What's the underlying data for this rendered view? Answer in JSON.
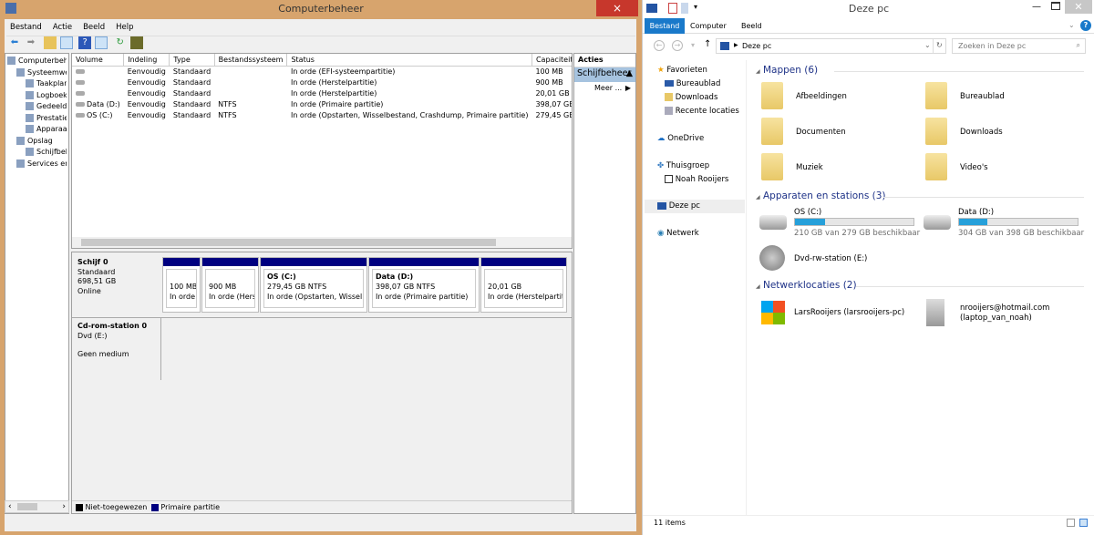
{
  "computer_management": {
    "title": "Computerbeheer",
    "close_icon": "×",
    "menu": [
      "Bestand",
      "Actie",
      "Beeld",
      "Help"
    ],
    "tree": [
      {
        "label": "Computerbeheer",
        "level": 0
      },
      {
        "label": "Systeemwerkset",
        "level": 1
      },
      {
        "label": "Taakplanner",
        "level": 2
      },
      {
        "label": "Logboeken",
        "level": 2
      },
      {
        "label": "Gedeelde mappen",
        "level": 2
      },
      {
        "label": "Prestaties",
        "level": 2
      },
      {
        "label": "Apparaatbeheer",
        "level": 2
      },
      {
        "label": "Opslag",
        "level": 1
      },
      {
        "label": "Schijfbeheer",
        "level": 2
      },
      {
        "label": "Services en toepassingen",
        "level": 1
      }
    ],
    "columns": [
      "Volume",
      "Indeling",
      "Type",
      "Bestandssysteem",
      "Status",
      "Capaciteit"
    ],
    "rows": [
      [
        "",
        "Eenvoudig",
        "Standaard",
        "",
        "In orde (EFI-systeempartitie)",
        "100 MB"
      ],
      [
        "",
        "Eenvoudig",
        "Standaard",
        "",
        "In orde (Herstelpartitie)",
        "900 MB"
      ],
      [
        "",
        "Eenvoudig",
        "Standaard",
        "",
        "In orde (Herstelpartitie)",
        "20,01 GB"
      ],
      [
        "Data (D:)",
        "Eenvoudig",
        "Standaard",
        "NTFS",
        "In orde (Primaire partitie)",
        "398,07 GB"
      ],
      [
        "OS (C:)",
        "Eenvoudig",
        "Standaard",
        "NTFS",
        "In orde (Opstarten, Wisselbestand, Crashdump, Primaire partitie)",
        "279,45 GB"
      ]
    ],
    "disk0": {
      "name": "Schijf 0",
      "type": "Standaard",
      "size": "698,51 GB",
      "state": "Online",
      "partitions": [
        {
          "title": "",
          "size": "100 MB",
          "status": "In orde (EFI-systeempartitie)"
        },
        {
          "title": "",
          "size": "900 MB",
          "status": "In orde (Herstelpartitie)"
        },
        {
          "title": "OS  (C:)",
          "size": "279,45 GB NTFS",
          "status": "In orde (Opstarten, Wisselbestand, Crashdump, Primaire partitie)"
        },
        {
          "title": "Data  (D:)",
          "size": "398,07 GB NTFS",
          "status": "In orde (Primaire partitie)"
        },
        {
          "title": "",
          "size": "20,01 GB",
          "status": "In orde (Herstelpartitie)"
        }
      ]
    },
    "cdrom": {
      "name": "Cd-rom-station 0",
      "type": "Dvd (E:)",
      "state": "Geen medium"
    },
    "legend": [
      {
        "label": "Niet-toegewezen",
        "color": "#000000"
      },
      {
        "label": "Primaire partitie",
        "color": "#000080"
      }
    ],
    "actions": {
      "header": "Acties",
      "section": "Schijfbeheer",
      "more": "Meer ..."
    }
  },
  "explorer": {
    "title": "Deze pc",
    "tabs": [
      "Bestand",
      "Computer",
      "Beeld"
    ],
    "address": "Deze pc",
    "search_placeholder": "Zoeken in Deze pc",
    "nav": {
      "favorites": "Favorieten",
      "fav_items": [
        "Bureaublad",
        "Downloads",
        "Recente locaties"
      ],
      "onedrive": "OneDrive",
      "homegroup": "Thuisgroep",
      "homegroup_user": "Noah Rooijers",
      "thispc": "Deze pc",
      "network": "Netwerk"
    },
    "folders_header": "Mappen (6)",
    "folders": [
      "Afbeeldingen",
      "Bureaublad",
      "Documenten",
      "Downloads",
      "Muziek",
      "Video's"
    ],
    "devices_header": "Apparaten en stations (3)",
    "drives": [
      {
        "name": "OS (C:)",
        "free": "210 GB van 279 GB beschikbaar",
        "used_fraction": 0.25
      },
      {
        "name": "Data (D:)",
        "free": "304 GB van 398 GB beschikbaar",
        "used_fraction": 0.24
      }
    ],
    "dvd": "Dvd-rw-station (E:)",
    "network_header": "Netwerklocaties (2)",
    "netlocs": [
      {
        "name": "LarsRooijers (larsrooijers-pc)"
      },
      {
        "name": "nrooijers@hotmail.com",
        "sub": "(laptop_van_noah)"
      }
    ],
    "status": "11 items",
    "accent": "#1979ca"
  }
}
